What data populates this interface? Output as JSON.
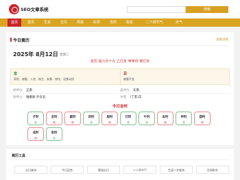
{
  "header": {
    "site_name": "SEO文章系统",
    "search": {
      "placeholder": "",
      "value": "",
      "button_label": "搜索"
    }
  },
  "nav": {
    "items": [
      "首页",
      "首页",
      "生肖",
      "五行",
      "周易",
      "彩票",
      "吉时",
      "取名",
      "二十四节气",
      "天气"
    ],
    "active_index": 0
  },
  "almanac": {
    "title": "今日黄历",
    "more_label": "查看详情",
    "solar_date": "2025年 8月12日",
    "weekday": "星期二",
    "lunar": "农历 闰六月十九 乙巳年 甲申月 癸巳日",
    "yi": {
      "label": "宜",
      "text": "祭祀、嫁娶、入宅、纳主、安葬、修坟、浴食动用"
    },
    "ji": {
      "label": "忌",
      "text": "嫁娶不宜"
    },
    "info": [
      {
        "key": "财神位:",
        "value": "正南"
      },
      {
        "key": "喜神位:",
        "value": "东南"
      },
      {
        "key": "胎神占:",
        "value": "碓磨厕 外东北"
      },
      {
        "key": "冲煞:",
        "value": "(丁亥)羊"
      }
    ],
    "hours_title": "今日吉时",
    "hours": [
      {
        "name": "子时",
        "status": "吉",
        "good": true
      },
      {
        "name": "丑时",
        "status": "凶",
        "good": false
      },
      {
        "name": "寅时",
        "status": "凶",
        "good": false
      },
      {
        "name": "卯时",
        "status": "吉",
        "good": true
      },
      {
        "name": "辰时",
        "status": "凶",
        "good": false
      },
      {
        "name": "巳时",
        "status": "吉",
        "good": true
      },
      {
        "name": "午时",
        "status": "吉",
        "good": true
      },
      {
        "name": "未时",
        "status": "凶",
        "good": false
      },
      {
        "name": "申时",
        "status": "吉",
        "good": true
      },
      {
        "name": "酉时",
        "status": "凶",
        "good": false
      },
      {
        "name": "戌时",
        "status": "凶",
        "good": false
      },
      {
        "name": "亥时",
        "status": "吉",
        "good": true
      }
    ]
  },
  "tools": {
    "title": "黄历工具",
    "items": [
      "吉日查询",
      "今日运势",
      "黄道吉日",
      "二十四节气",
      "生辰八字查询",
      "在线取名"
    ]
  },
  "colors": {
    "brand_red": "#c8232b",
    "nav_gold": "#d9a420",
    "good_green": "#2f8a3a"
  }
}
